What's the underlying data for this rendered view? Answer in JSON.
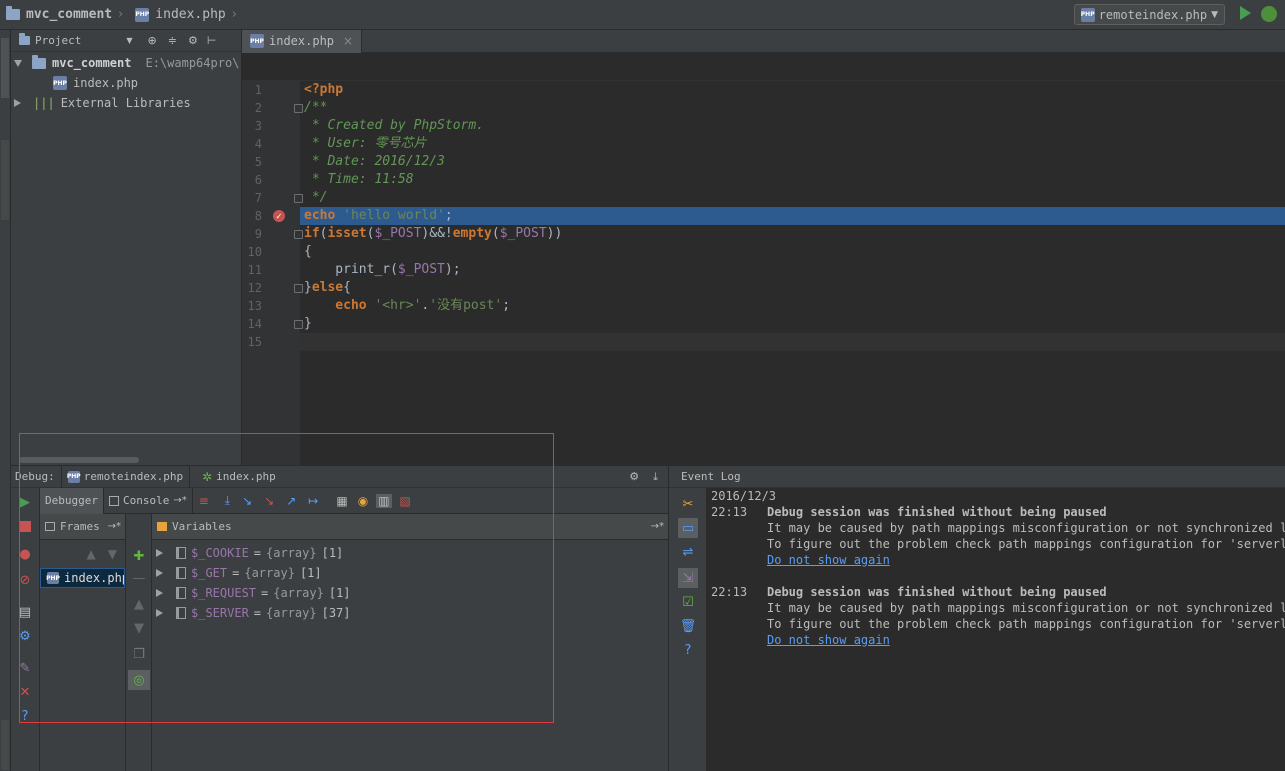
{
  "navbar": {
    "project_name": "mvc_comment",
    "file_name": "index.php",
    "run_config": "remoteindex.php"
  },
  "project_panel": {
    "title": "Project",
    "root_name": "mvc_comment",
    "root_path": "E:\\wamp64pro\\",
    "file": "index.php",
    "external": "External Libraries"
  },
  "editor": {
    "tab": "index.php",
    "line_numbers": [
      "1",
      "2",
      "3",
      "4",
      "5",
      "6",
      "7",
      "8",
      "9",
      "10",
      "11",
      "12",
      "13",
      "14",
      "15"
    ],
    "breakpoint_line": 8,
    "code": {
      "l1": "<?php",
      "l2": "/**",
      "l3": " * Created by PhpStorm.",
      "l4": " * User: 零号芯片",
      "l5": " * Date: 2016/12/3",
      "l6": " * Time: 11:58",
      "l7": " */",
      "l8_kw": "echo",
      "l8_str": "'hello world'",
      "l8_end": ";",
      "l9_kw1": "if",
      "l9_a": "(",
      "l9_kw2": "isset",
      "l9_b": "(",
      "l9_var1": "$_POST",
      "l9_c": ")&&!",
      "l9_kw3": "empty",
      "l9_d": "(",
      "l9_var2": "$_POST",
      "l9_e": "))",
      "l10": "{",
      "l11_fn": "    print_r(",
      "l11_var": "$_POST",
      "l11_end": ");",
      "l12_a": "}",
      "l12_kw": "else",
      "l12_b": "{",
      "l13_kw": "    echo",
      "l13_s1": "'<hr>'",
      "l13_dot": ".",
      "l13_s2": "'没有post'",
      "l13_end": ";",
      "l14": "}"
    }
  },
  "debug": {
    "label": "Debug:",
    "session_tab": "remoteindex.php",
    "index_tab": "index.php",
    "debugger_tab": "Debugger",
    "console_tab": "Console",
    "frames_title": "Frames",
    "frame_item": "index.php",
    "variables_title": "Variables",
    "variables": [
      {
        "name": "$_COOKIE",
        "eq": "=",
        "type": "{array}",
        "count": "[1]"
      },
      {
        "name": "$_GET",
        "eq": "=",
        "type": "{array}",
        "count": "[1]"
      },
      {
        "name": "$_REQUEST",
        "eq": "=",
        "type": "{array}",
        "count": "[1]"
      },
      {
        "name": "$_SERVER",
        "eq": "=",
        "type": "{array}",
        "count": "[37]"
      }
    ]
  },
  "event_log": {
    "title": "Event Log",
    "date": "2016/12/3",
    "entries": [
      {
        "time": "22:13",
        "title": "Debug session was finished without being paused",
        "line1": "It may be caused by path mappings misconfiguration or not synchronized loc",
        "line2": "To figure out the problem check path mappings configuration for 'serverloc",
        "link": "Do not show again"
      },
      {
        "time": "22:13",
        "title": "Debug session was finished without being paused",
        "line1": "It may be caused by path mappings misconfiguration or not synchronized loc",
        "line2": "To figure out the problem check path mappings configuration for 'serverloc",
        "link": "Do not show again"
      }
    ]
  },
  "colors": {
    "background": "#3c3f41",
    "editor_bg": "#2b2b2b",
    "highlight_line": "#2d5b8f",
    "keyword": "#cc7832",
    "comment": "#629755",
    "string": "#6a8759",
    "variable": "#9876aa",
    "link": "#589df6",
    "annotation_rect": "#e0393e"
  }
}
